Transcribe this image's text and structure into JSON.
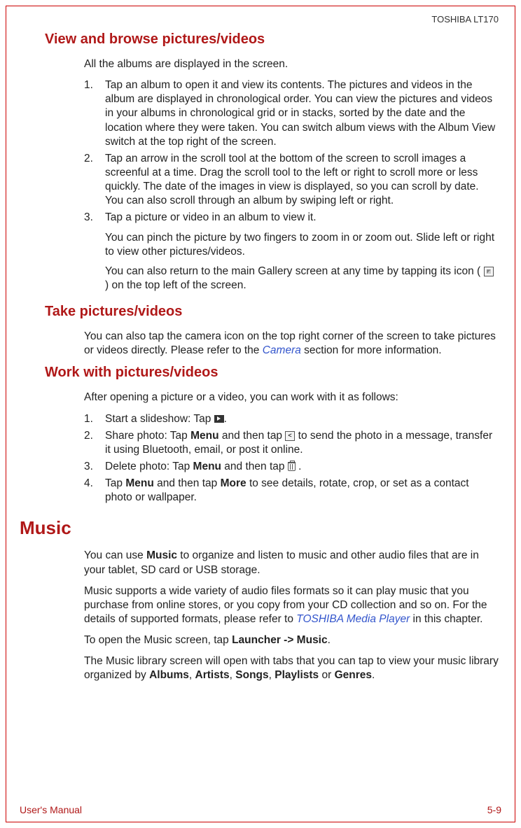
{
  "header": {
    "product": "TOSHIBA LT170"
  },
  "sections": {
    "s1": {
      "title": "View and browse pictures/videos",
      "intro": "All the albums are displayed in the screen.",
      "items": [
        {
          "num": "1.",
          "text": "Tap an album to open it and view its contents. The pictures and videos in the album are displayed in chronological order. You can view the pictures and videos in your albums in chronological grid or in stacks, sorted by the date and the location where they were taken. You can switch album views with the Album View switch at the top right of the screen."
        },
        {
          "num": "2.",
          "text": "Tap an arrow in the scroll tool at the bottom of the screen to scroll images a screenful at a time. Drag the scroll tool to the left or right to scroll more or less quickly. The date of the images in view is displayed, so you can scroll by date. You can also scroll through an album by swiping left or right."
        },
        {
          "num": "3.",
          "paras": [
            "Tap a picture or video in an album to view it.",
            "You can pinch the picture by two fingers to zoom in or zoom out. Slide left or right to view other pictures/videos.",
            "You can also return to the main Gallery screen at any time by tapping its icon ( ",
            " ) on the top left of the screen."
          ]
        }
      ]
    },
    "s2": {
      "title": "Take pictures/videos",
      "text_pre": "You can also tap the camera icon on the top right corner of the screen to take pictures or videos directly. Please refer to the ",
      "link": "Camera",
      "text_post": " section for more information."
    },
    "s3": {
      "title": "Work with pictures/videos",
      "intro": "After opening a picture or a video, you can work with it as follows:",
      "items": [
        {
          "num": "1.",
          "pre": "Start a slideshow: Tap ",
          "post": "."
        },
        {
          "num": "2.",
          "pre": "Share photo: Tap ",
          "bold1": "Menu",
          "mid": " and then tap ",
          "post": " to send the photo in a message, transfer it using Bluetooth, email, or post it online."
        },
        {
          "num": "3.",
          "pre": "Delete photo: Tap ",
          "bold1": "Menu",
          "mid": " and then tap ",
          "post": " ."
        },
        {
          "num": "4.",
          "pre": "Tap ",
          "bold1": "Menu",
          "mid": " and then tap ",
          "bold2": "More",
          "post": " to see details, rotate, crop, or set as a contact photo or wallpaper."
        }
      ]
    },
    "s4": {
      "title": "Music",
      "p1_pre": "You can use ",
      "p1_bold": "Music",
      "p1_post": " to organize and listen to music and other audio files that are in your tablet, SD card or USB storage.",
      "p2_pre": "Music supports a wide variety of audio files formats so it can play music that you purchase from online stores, or you copy from your CD collection and so on. For the details of supported formats, please refer to ",
      "p2_link": "TOSHIBA Media Player",
      "p2_post": " in this chapter.",
      "p3_pre": "To open the Music screen, tap ",
      "p3_bold": "Launcher -> Music",
      "p3_post": ".",
      "p4_pre": "The Music library screen will open with tabs that you can tap to view your music library organized by ",
      "p4_b1": "Albums",
      "p4_s1": ", ",
      "p4_b2": "Artists",
      "p4_s2": ", ",
      "p4_b3": "Songs",
      "p4_s3": ", ",
      "p4_b4": "Playlists",
      "p4_s4": " or ",
      "p4_b5": "Genres",
      "p4_end": "."
    }
  },
  "footer": {
    "left": "User's Manual",
    "right": "5-9"
  }
}
